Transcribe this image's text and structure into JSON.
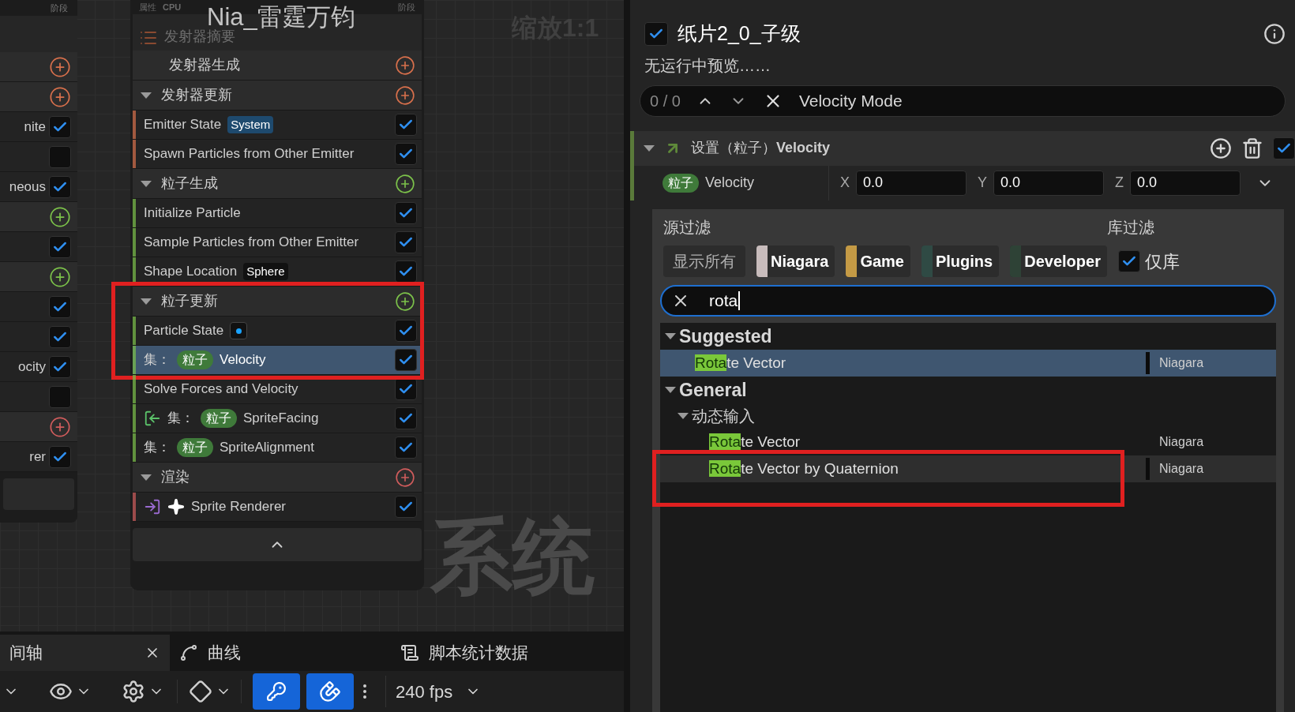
{
  "canvas": {
    "title": "Nia_雷霆万钧",
    "zoom": "缩放1:1",
    "watermark": "系统"
  },
  "left_node": {
    "header": "阶段",
    "rows": [
      {
        "kind": "add",
        "color": "#d8704c"
      },
      {
        "kind": "add",
        "color": "#d8704c"
      },
      {
        "kind": "check",
        "label": "nite",
        "checked": true
      },
      {
        "kind": "check",
        "checked": false
      },
      {
        "kind": "check",
        "label": "neous",
        "checked": true
      },
      {
        "kind": "add",
        "color": "#7cc24a"
      },
      {
        "kind": "check",
        "checked": true
      },
      {
        "kind": "add",
        "color": "#7cc24a"
      },
      {
        "kind": "check",
        "checked": true
      },
      {
        "kind": "check",
        "checked": true
      },
      {
        "kind": "check",
        "label": "ocity",
        "checked": true
      },
      {
        "kind": "check",
        "checked": false
      },
      {
        "kind": "add",
        "color": "#d05c5c"
      },
      {
        "kind": "check",
        "label": "rer",
        "checked": true
      }
    ]
  },
  "center_node": {
    "header": {
      "label": "属性",
      "mode": "CPU",
      "stage": "阶段"
    },
    "summary": "发射器摘要",
    "stages": [
      {
        "kind": "stage_leaf",
        "label": "发射器生成",
        "color": "#d8704c"
      },
      {
        "kind": "stage",
        "label": "发射器更新",
        "color": "#d8704c",
        "expanded": true,
        "modules": [
          {
            "kind": "system-tag",
            "label": "Emitter State",
            "tag": "System",
            "checked": true,
            "selected": false
          },
          {
            "kind": "plain",
            "label": "Spawn Particles from Other Emitter",
            "checked": true,
            "selected": false
          }
        ]
      },
      {
        "kind": "stage",
        "label": "粒子生成",
        "color": "#7cc24a",
        "expanded": true,
        "modules": [
          {
            "kind": "plain",
            "label": "Initialize Particle",
            "checked": true,
            "selected": false
          },
          {
            "kind": "plain",
            "label": "Sample Particles from Other Emitter",
            "checked": true,
            "selected": false
          },
          {
            "kind": "value-tag",
            "label": "Shape Location",
            "tag": "Sphere",
            "checked": true,
            "selected": false
          }
        ]
      },
      {
        "kind": "stage",
        "label": "粒子更新",
        "color": "#7cc24a",
        "expanded": true,
        "modules": [
          {
            "kind": "state-dot",
            "label": "Particle State",
            "checked": true,
            "selected": false
          },
          {
            "kind": "set",
            "prefix": "集：",
            "namespace": "粒子",
            "label": "Velocity",
            "checked": true,
            "selected": true
          },
          {
            "kind": "plain",
            "label": "Solve Forces and Velocity",
            "checked": true,
            "selected": false
          },
          {
            "kind": "set-linked",
            "prefix": "集：",
            "namespace": "粒子",
            "label": "SpriteFacing",
            "checked": true,
            "selected": false
          },
          {
            "kind": "set",
            "prefix": "集：",
            "namespace": "粒子",
            "label": "SpriteAlignment",
            "checked": true,
            "selected": false
          }
        ]
      },
      {
        "kind": "stage",
        "label": "渲染",
        "color": "#d05c5c",
        "expanded": true,
        "modules": [
          {
            "kind": "renderer",
            "label": "Sprite Renderer",
            "checked": true,
            "selected": false
          }
        ]
      }
    ]
  },
  "bottom_tabs": [
    {
      "kind": "closable",
      "label": "间轴",
      "selected": true
    },
    {
      "kind": "curve",
      "label": "曲线",
      "selected": false
    },
    {
      "kind": "scroll",
      "label": "脚本统计数据",
      "selected": false
    }
  ],
  "toolbar": [
    {
      "kind": "chevron"
    },
    {
      "kind": "eye"
    },
    {
      "kind": "play-settings"
    },
    {
      "kind": "keyframe"
    },
    {
      "kind": "key",
      "on": true
    },
    {
      "kind": "snap",
      "on": true
    },
    {
      "kind": "more"
    },
    {
      "kind": "fps",
      "label": "240 fps"
    }
  ],
  "details": {
    "enabled": true,
    "title": "纸片2_0_子级",
    "subtitle": "无运行中预览……",
    "search": {
      "counter": "0 / 0",
      "value": "Velocity Mode"
    },
    "module": {
      "title": "设置（粒子）**Velocity**",
      "expanded": true,
      "enabled": true,
      "param": {
        "namespace": "粒子",
        "label": "Velocity",
        "fields": [
          {
            "axis": "X",
            "value": "0.0"
          },
          {
            "axis": "Y",
            "value": "0.0"
          },
          {
            "axis": "Z",
            "value": "0.0"
          }
        ]
      }
    }
  },
  "popup": {
    "source_filter": "源过滤",
    "library_filter": "库过滤",
    "chips": [
      {
        "label": "显示所有"
      },
      {
        "label": "Niagara",
        "color": "#c8bcbc"
      },
      {
        "label": "Game",
        "color": "#c49a45"
      },
      {
        "label": "Plugins",
        "color": "#2f4a44"
      },
      {
        "label": "Developer",
        "color": "#2e4236"
      }
    ],
    "library_only": {
      "label": "仅库",
      "checked": true
    },
    "search": {
      "value": "rota"
    },
    "sections": [
      {
        "title": "Suggested",
        "expanded": true,
        "items": [
          {
            "match": "Rota",
            "rest": "te Vector",
            "source": "Niagara",
            "selected": true,
            "highlighted": true
          }
        ]
      },
      {
        "title": "General",
        "expanded": true,
        "children": [
          {
            "title": "动态输入",
            "expanded": true,
            "items": [
              {
                "match": "Rota",
                "rest": "te Vector",
                "source": "Niagara",
                "selected": false,
                "highlighted": false
              },
              {
                "match": "Rota",
                "rest": "te Vector by Quaternion",
                "source": "Niagara",
                "selected": false,
                "highlighted": true
              }
            ]
          }
        ]
      }
    ]
  }
}
